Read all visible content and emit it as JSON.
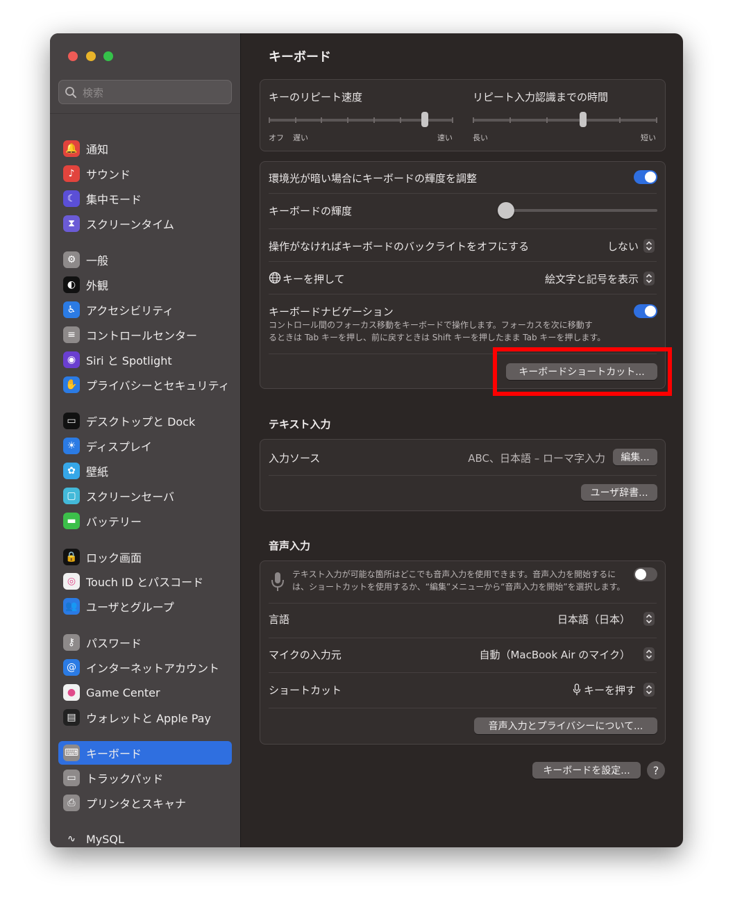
{
  "search": {
    "placeholder": "検索"
  },
  "sidebar": {
    "items": [
      {
        "label": "通知",
        "icon": "bell-icon",
        "color": "#e2443d"
      },
      {
        "label": "サウンド",
        "icon": "speaker-icon",
        "color": "#e2443d"
      },
      {
        "label": "集中モード",
        "icon": "moon-icon",
        "color": "#5b4fd6"
      },
      {
        "label": "スクリーンタイム",
        "icon": "hourglass-icon",
        "color": "#6b5bd6"
      },
      {
        "label": "一般",
        "icon": "gear-icon",
        "color": "#8e8a8a"
      },
      {
        "label": "外観",
        "icon": "appearance-icon",
        "color": "#111111"
      },
      {
        "label": "アクセシビリティ",
        "icon": "accessibility-icon",
        "color": "#2b7be4"
      },
      {
        "label": "コントロールセンター",
        "icon": "toggles-icon",
        "color": "#8e8a8a"
      },
      {
        "label": "Siri と Spotlight",
        "icon": "siri-icon",
        "color": "#6a3fd0"
      },
      {
        "label": "プライバシーとセキュリティ",
        "icon": "hand-icon",
        "color": "#2b7be4"
      },
      {
        "label": "デスクトップと Dock",
        "icon": "dock-icon",
        "color": "#111111"
      },
      {
        "label": "ディスプレイ",
        "icon": "sun-icon",
        "color": "#2b7be4"
      },
      {
        "label": "壁紙",
        "icon": "flower-icon",
        "color": "#36a7e8"
      },
      {
        "label": "スクリーンセーバ",
        "icon": "screensaver-icon",
        "color": "#43b9d9"
      },
      {
        "label": "バッテリー",
        "icon": "battery-icon",
        "color": "#3cbf4a"
      },
      {
        "label": "ロック画面",
        "icon": "lock-icon",
        "color": "#111111"
      },
      {
        "label": "Touch ID とパスコード",
        "icon": "fingerprint-icon",
        "color": "#f1f1f1"
      },
      {
        "label": "ユーザとグループ",
        "icon": "users-icon",
        "color": "#2b7be4"
      },
      {
        "label": "パスワード",
        "icon": "key-icon",
        "color": "#8e8a8a"
      },
      {
        "label": "インターネットアカウント",
        "icon": "at-icon",
        "color": "#2b7be4"
      },
      {
        "label": "Game Center",
        "icon": "game-center-icon",
        "color": "#f1f1f1"
      },
      {
        "label": "ウォレットと Apple Pay",
        "icon": "wallet-icon",
        "color": "#222222"
      },
      {
        "label": "キーボード",
        "icon": "keyboard-icon",
        "color": "#8e8a8a",
        "active": true
      },
      {
        "label": "トラックパッド",
        "icon": "trackpad-icon",
        "color": "#8e8a8a"
      },
      {
        "label": "プリンタとスキャナ",
        "icon": "printer-icon",
        "color": "#8e8a8a"
      },
      {
        "label": "MySQL",
        "icon": "dolphin-icon",
        "color": "#464243"
      }
    ]
  },
  "header": {
    "title": "キーボード"
  },
  "repeat": {
    "speed_label": "キーのリピート速度",
    "speed_off": "オフ",
    "speed_slow": "遅い",
    "speed_fast": "速い",
    "delay_label": "リピート入力認識までの時間",
    "delay_long": "長い",
    "delay_short": "短い"
  },
  "backlight": {
    "auto_label": "環境光が暗い場合にキーボードの輝度を調整",
    "auto_on": true,
    "brightness_label": "キーボードの輝度",
    "off_label": "操作がなければキーボードのバックライトをオフにする",
    "off_value": "しない",
    "globe_label": "キーを押して",
    "globe_value": "絵文字と記号を表示",
    "nav_label": "キーボードナビゲーション",
    "nav_on": true,
    "nav_desc_1": "コントロール間のフォーカス移動をキーボードで操作します。フォーカスを次に移動す",
    "nav_desc_2": "るときは Tab キーを押し、前に戻すときは Shift キーを押したまま Tab キーを押します。",
    "shortcuts_button": "キーボードショートカット..."
  },
  "text_input": {
    "title": "テキスト入力",
    "source_label": "入力ソース",
    "source_value": "ABC、日本語 – ローマ字入力",
    "edit_button": "編集...",
    "dict_button": "ユーザ辞書..."
  },
  "dictation": {
    "title": "音声入力",
    "desc_1": "テキスト入力が可能な箇所はどこでも音声入力を使用できます。音声入力を開始するに",
    "desc_2": "は、ショートカットを使用するか、“編集”メニューから“音声入力を開始”を選択します。",
    "on": false,
    "language_label": "言語",
    "language_value": "日本語（日本）",
    "mic_label": "マイクの入力元",
    "mic_value": "自動（MacBook Air のマイク）",
    "shortcut_label": "ショートカット",
    "shortcut_value": "キーを押す",
    "privacy_button": "音声入力とプライバシーについて..."
  },
  "footer": {
    "setup_button": "キーボードを設定...",
    "help_label": "?"
  },
  "colors": {
    "accent": "#2f6fe0",
    "highlight": "#ff0000"
  }
}
